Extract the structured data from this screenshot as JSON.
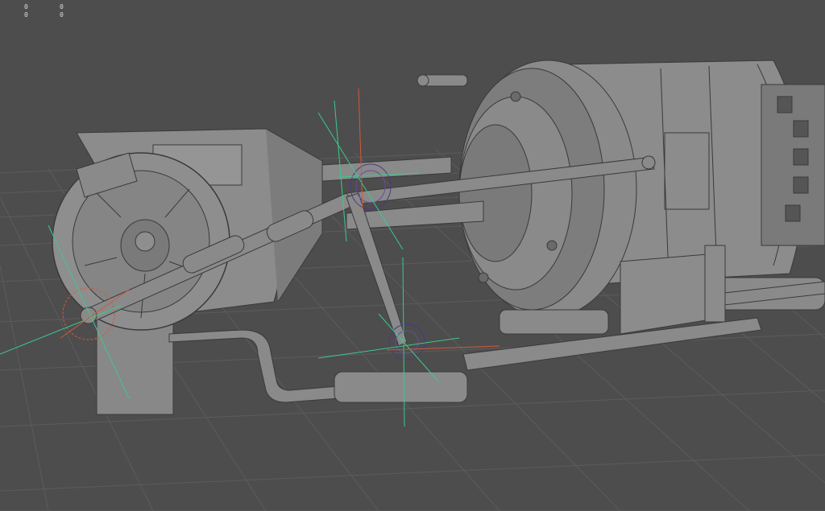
{
  "viewport": {
    "background": "#4d4d4d",
    "grid_color": "#5a5a5a",
    "mesh_fill": "#8a8a8a",
    "mesh_shade": "#6e6e6e",
    "mesh_edge": "#3a3a3a"
  },
  "hud": {
    "values": [
      "0",
      "0",
      "0",
      "0"
    ]
  },
  "gizmos": {
    "axis_x_color": "#d05a3c",
    "axis_y_color": "#3cc88c",
    "rig_color": "#5a3c8c",
    "items": [
      "upper-joint",
      "lower-joint",
      "left-pivot"
    ]
  }
}
